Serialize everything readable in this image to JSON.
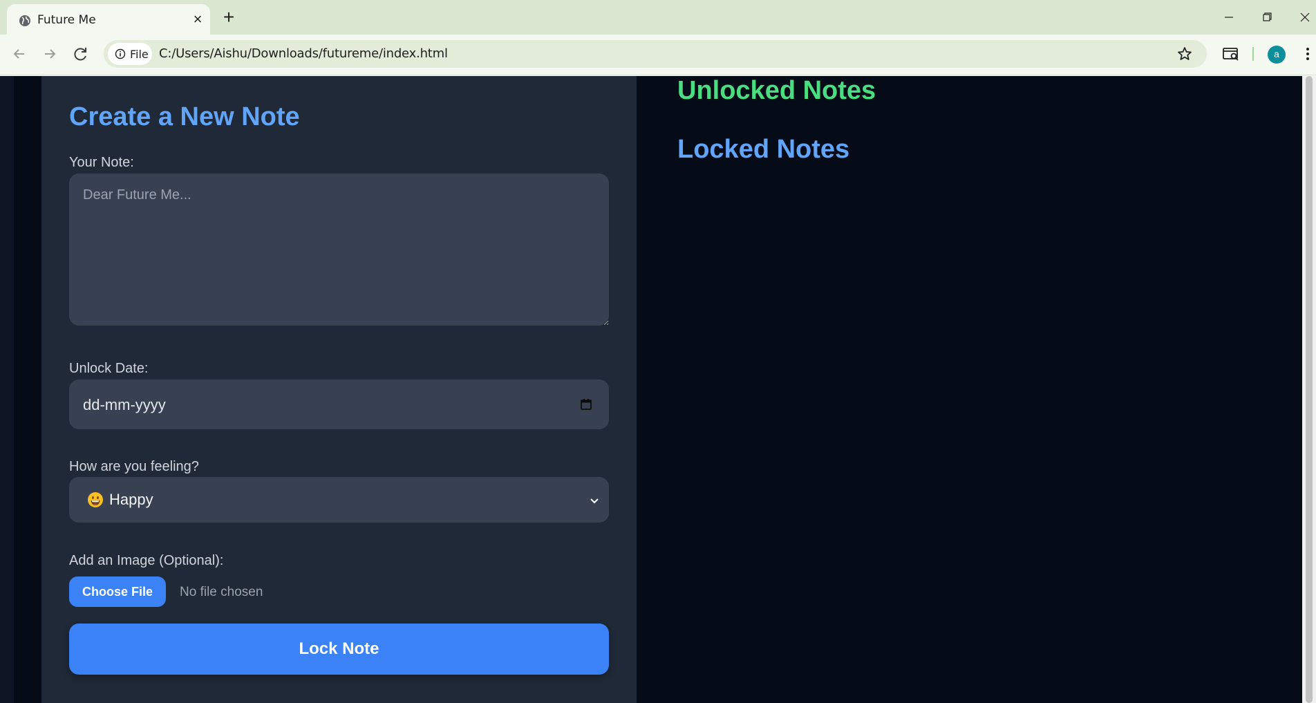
{
  "browser": {
    "tab": {
      "title": "Future Me",
      "icon": "globe-icon"
    },
    "address_bar": {
      "scheme_label": "File",
      "url": "C:/Users/Aishu/Downloads/futureme/index.html"
    },
    "profile": {
      "initial": "a",
      "color": "#0b8f9c"
    }
  },
  "page": {
    "form": {
      "title": "Create a New Note",
      "note_label": "Your Note:",
      "note_placeholder": "Dear Future Me...",
      "note_value": "",
      "date_label": "Unlock Date:",
      "date_placeholder": "dd-mm-yyyy",
      "mood_label": "How are you feeling?",
      "mood_selected": "Happy",
      "mood_icon": "grinning-face-icon",
      "image_label": "Add an Image (Optional):",
      "file_button_label": "Choose File",
      "file_status": "No file chosen",
      "submit_label": "Lock Note"
    },
    "sections": {
      "unlocked_title": "Unlocked Notes",
      "locked_title": "Locked Notes"
    },
    "colors": {
      "accent_blue": "#60a5fa",
      "button_blue": "#3b82f6",
      "accent_green": "#4ade80",
      "card": "#1f2937",
      "input": "#374151",
      "background": "#030712"
    }
  }
}
